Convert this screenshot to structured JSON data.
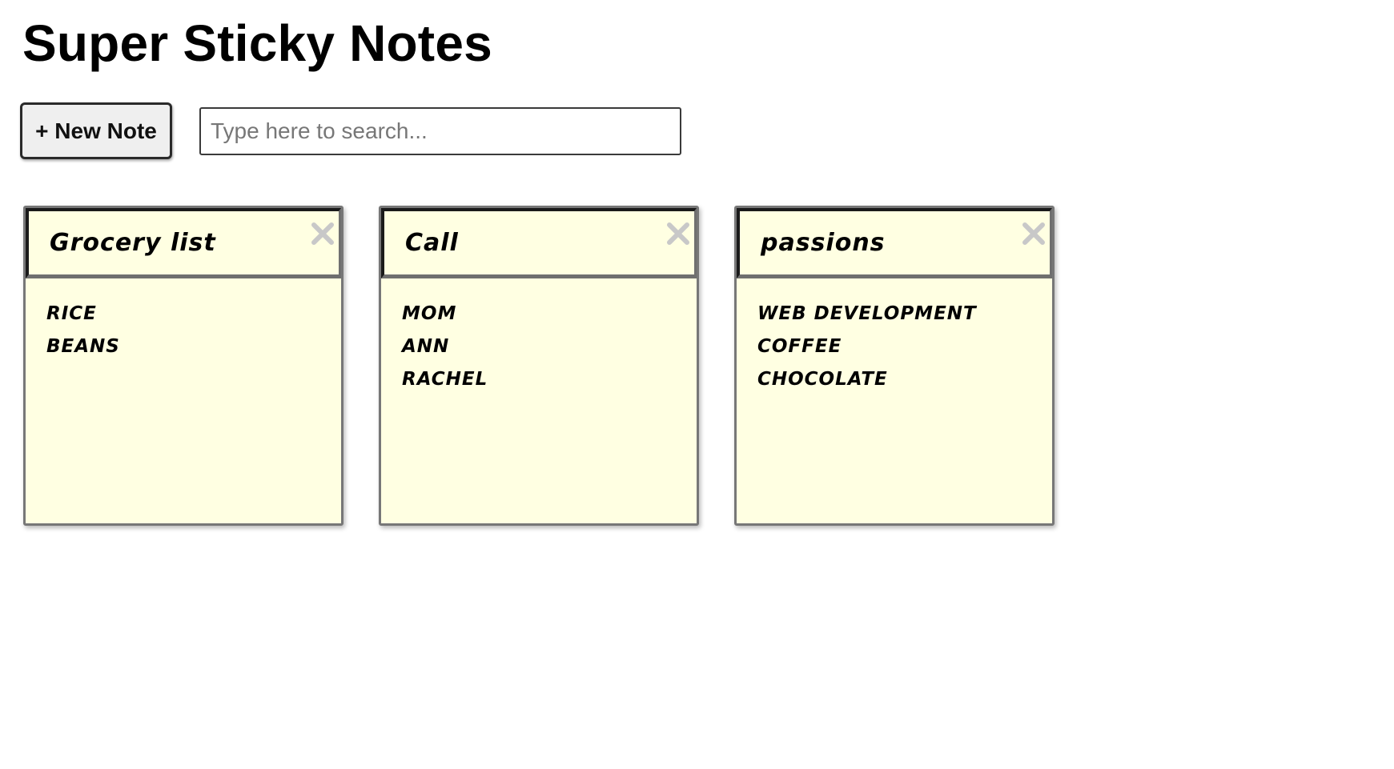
{
  "app": {
    "title": "Super Sticky Notes"
  },
  "toolbar": {
    "new_note_label": "+ New Note",
    "search_placeholder": "Type here to search...",
    "search_value": ""
  },
  "notes": [
    {
      "title": "Grocery list",
      "close_icon": "close-x-icon",
      "lines": [
        "rice",
        "beans"
      ]
    },
    {
      "title": "Call",
      "close_icon": "close-x-icon",
      "lines": [
        "mom",
        "ann",
        "rachel"
      ]
    },
    {
      "title": "passions",
      "close_icon": "close-x-icon",
      "lines": [
        "web development",
        "coffee",
        "chocolate"
      ]
    }
  ],
  "colors": {
    "note_background": "#ffffe2",
    "close_icon": "#c8c8c8"
  }
}
